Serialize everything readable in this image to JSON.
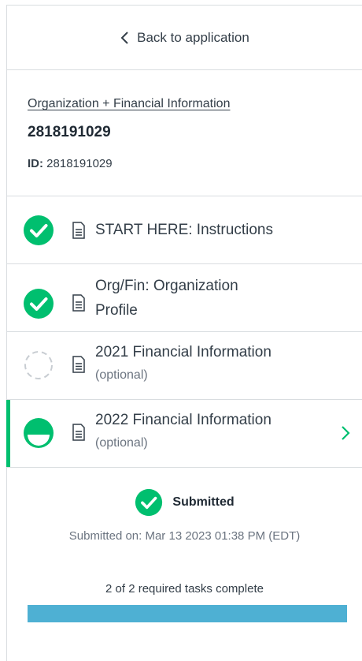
{
  "back": {
    "label": "Back to application"
  },
  "organization": {
    "section_link": "Organization + Financial Information",
    "name": "2818191029",
    "id_label": "ID:",
    "id_value": "2818191029"
  },
  "tasks": [
    {
      "title": "START HERE: Instructions",
      "subtitle": "",
      "status": "complete"
    },
    {
      "title": "Org/Fin: Organization Profile",
      "subtitle": "",
      "status": "complete"
    },
    {
      "title": "2021 Financial Information",
      "subtitle": "(optional)",
      "status": "not-started"
    },
    {
      "title": "2022 Financial Information",
      "subtitle": "(optional)",
      "status": "in-progress",
      "active": true
    }
  ],
  "submission": {
    "status_label": "Submitted",
    "date_text": "Submitted on: Mar 13 2023 01:38 PM (EDT)"
  },
  "progress": {
    "label": "2 of 2 required tasks complete",
    "completed": 2,
    "total": 2
  },
  "colors": {
    "accent_green": "#00bf6f",
    "progress_blue": "#4eb0d3",
    "dashed_gray": "#c8cdd2"
  },
  "icons": {
    "back": "chevron-left-icon",
    "doc": "document-icon",
    "complete": "check-circle-icon",
    "not_started": "dashed-circle-icon",
    "in_progress": "half-circle-icon",
    "arrow": "chevron-right-icon"
  }
}
